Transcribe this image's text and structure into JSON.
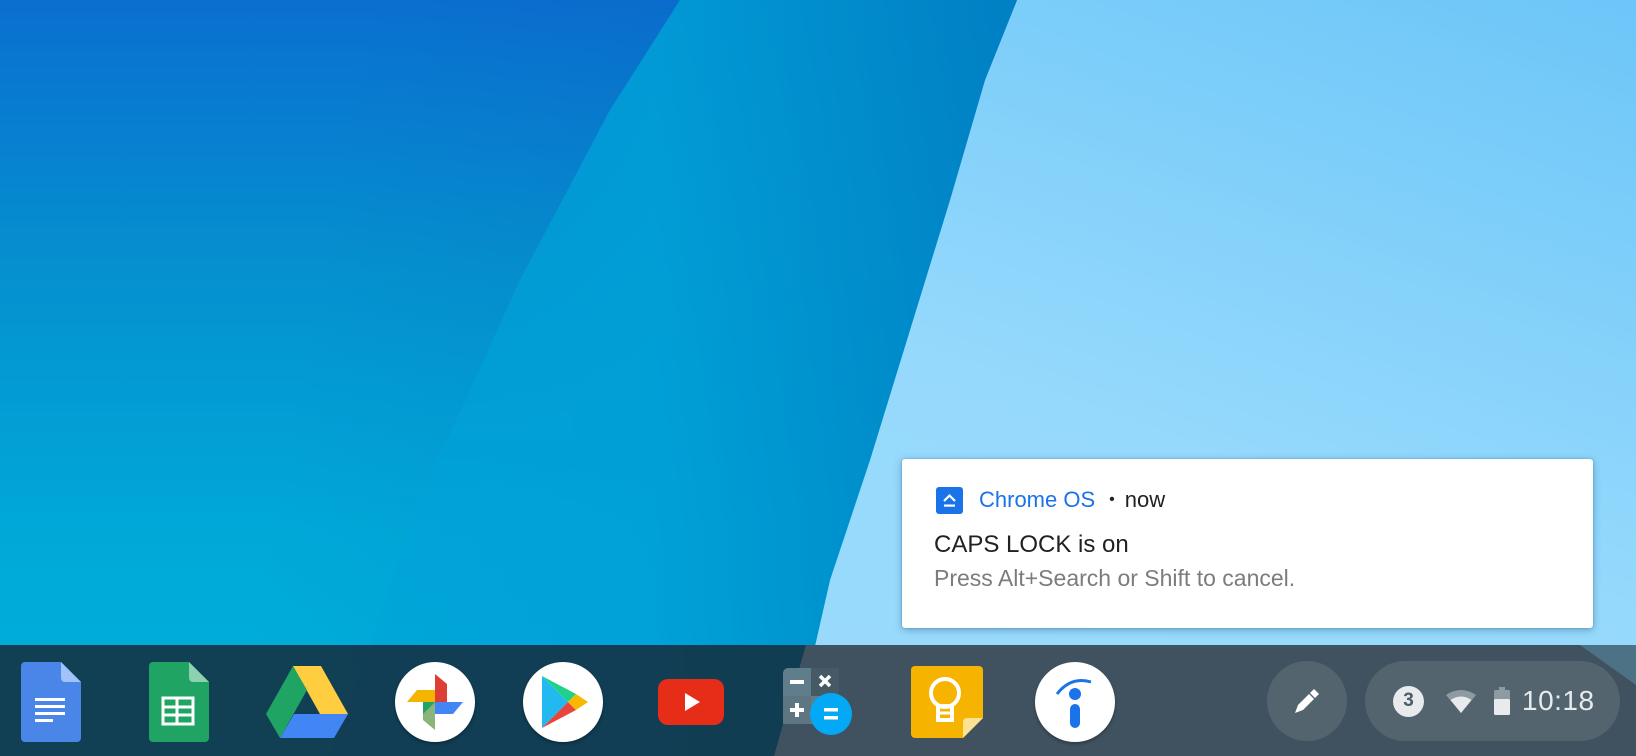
{
  "notification": {
    "app_icon": "caps-lock-icon",
    "app_name": "Chrome OS",
    "separator": "•",
    "time": "now",
    "title": "CAPS LOCK is on",
    "message": "Press Alt+Search or Shift to cancel.",
    "accent_color": "#1a73e8"
  },
  "shelf": {
    "apps": [
      {
        "name": "Google Docs",
        "icon": "google-docs-icon"
      },
      {
        "name": "Google Sheets",
        "icon": "google-sheets-icon"
      },
      {
        "name": "Google Drive",
        "icon": "google-drive-icon"
      },
      {
        "name": "Google Photos",
        "icon": "google-photos-icon"
      },
      {
        "name": "Google Play Store",
        "icon": "play-store-icon"
      },
      {
        "name": "YouTube",
        "icon": "youtube-icon"
      },
      {
        "name": "Calculator",
        "icon": "calculator-icon"
      },
      {
        "name": "Google Keep",
        "icon": "google-keep-icon"
      },
      {
        "name": "Info",
        "icon": "info-app-icon"
      }
    ]
  },
  "status_tray": {
    "stylus_icon": "stylus-pen-icon",
    "notification_count": "3",
    "wifi_icon": "wifi-icon",
    "battery_icon": "battery-icon",
    "time": "10:18"
  }
}
